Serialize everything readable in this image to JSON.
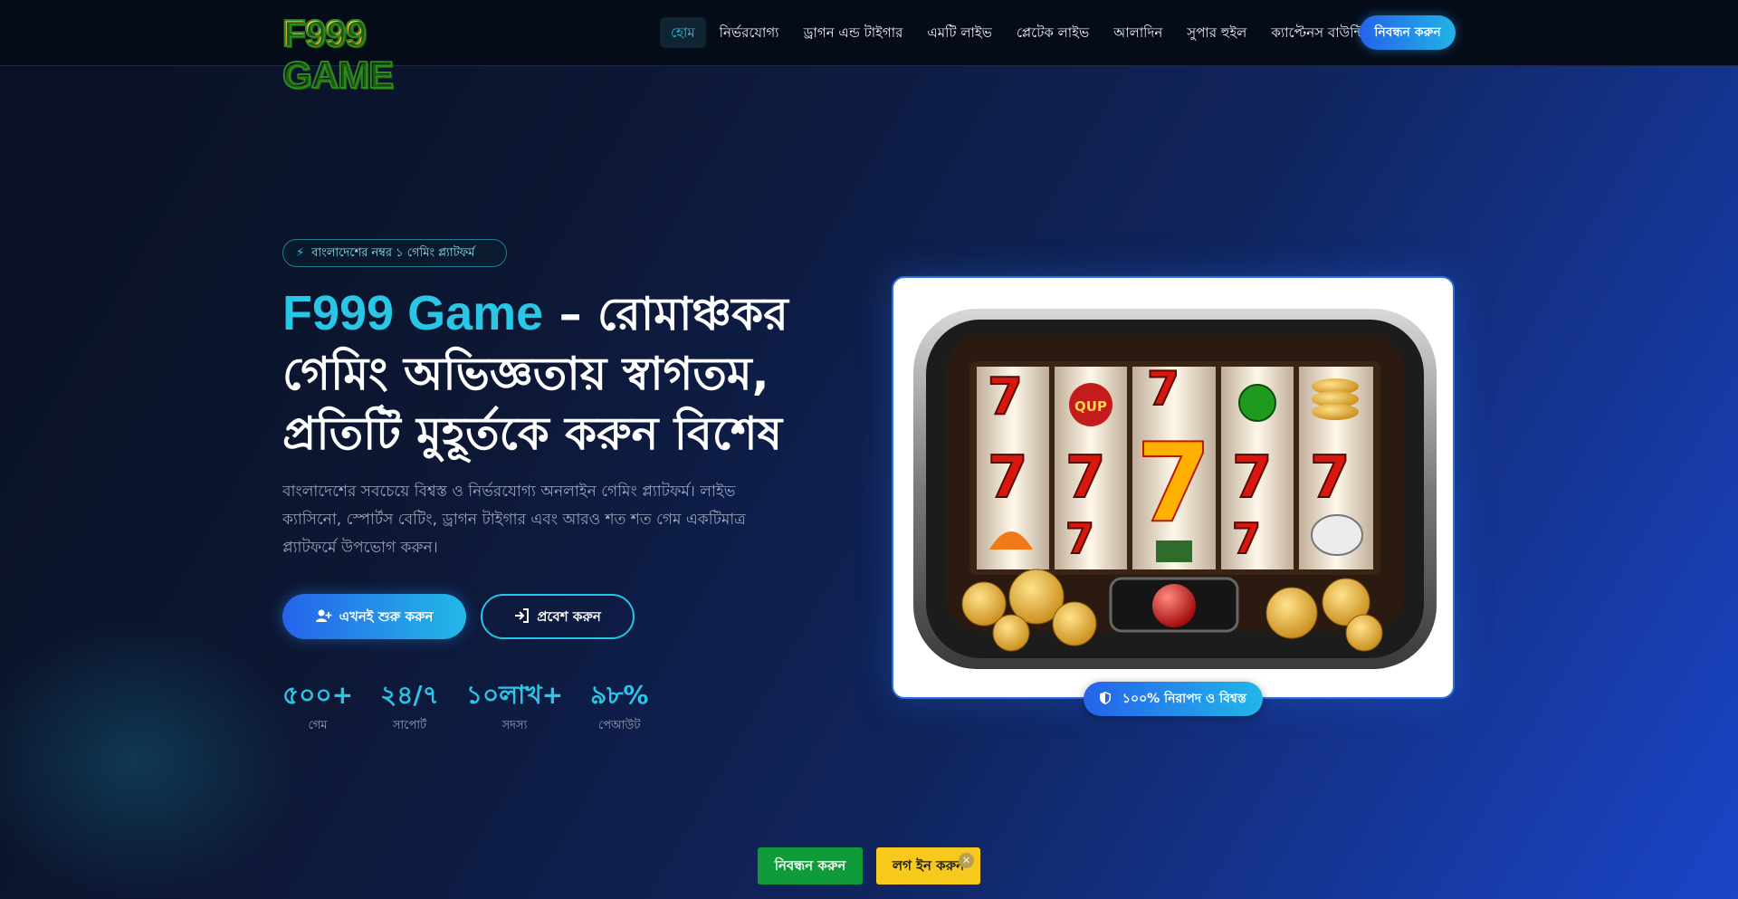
{
  "logo": {
    "text": "F999 GAME"
  },
  "nav": {
    "links": [
      {
        "label": "হোম",
        "active": true
      },
      {
        "label": "নির্ভরযোগ্য",
        "active": false
      },
      {
        "label": "ড্রাগন এন্ড টাইগার",
        "active": false
      },
      {
        "label": "এমটি লাইভ",
        "active": false
      },
      {
        "label": "প্লেটেক লাইভ",
        "active": false
      },
      {
        "label": "আলাদিন",
        "active": false
      },
      {
        "label": "সুপার হুইল",
        "active": false
      },
      {
        "label": "ক্যাপ্টেনস বাউন্টি",
        "active": false
      }
    ],
    "cta_label": "নিবন্ধন করুন"
  },
  "hero": {
    "badge_text": "বাংলাদেশের নম্বর ১ গেমিং প্ল্যাটফর্ম",
    "title_brand": "F999 Game",
    "title_rest": " – রোমাঞ্চকর গেমিং অভিজ্ঞতায় স্বাগতম, প্রতিটি মুহূর্তকে করুন বিশেষ",
    "description": "বাংলাদেশের সবচেয়ে বিশ্বস্ত ও নির্ভরযোগ্য অনলাইন গেমিং প্ল্যাটফর্ম। লাইভ ক্যাসিনো, স্পোর্টস বেটিং, ড্রাগন টাইগার এবং আরও শত শত গেম একটিমাত্র প্ল্যাটফর্মে উপভোগ করুন।",
    "primary_button": "এখনই শুরু করুন",
    "secondary_button": "প্রবেশ করুন",
    "stats": [
      {
        "value": "৫০০+",
        "label": "গেম"
      },
      {
        "value": "২৪/৭",
        "label": "সাপোর্ট"
      },
      {
        "value": "১০লাখ+",
        "label": "সদস্য"
      },
      {
        "value": "৯৮%",
        "label": "পেআউট"
      }
    ],
    "secure_badge": "১০০% নিরাপদ ও বিশ্বস্ত"
  },
  "bottom_bar": {
    "register_label": "নিবন্ধন করুন",
    "login_label": "লগ ইন করুন",
    "close_symbol": "✕"
  },
  "colors": {
    "accent": "#29c6e6",
    "primary_blue": "#2563eb",
    "register_green": "#0f9b3a",
    "login_yellow": "#f7c91c"
  },
  "icons": {
    "badge": "bolt-icon",
    "primary_button": "user-plus-icon",
    "secondary_button": "sign-in-icon",
    "secure_badge": "shield-icon"
  }
}
